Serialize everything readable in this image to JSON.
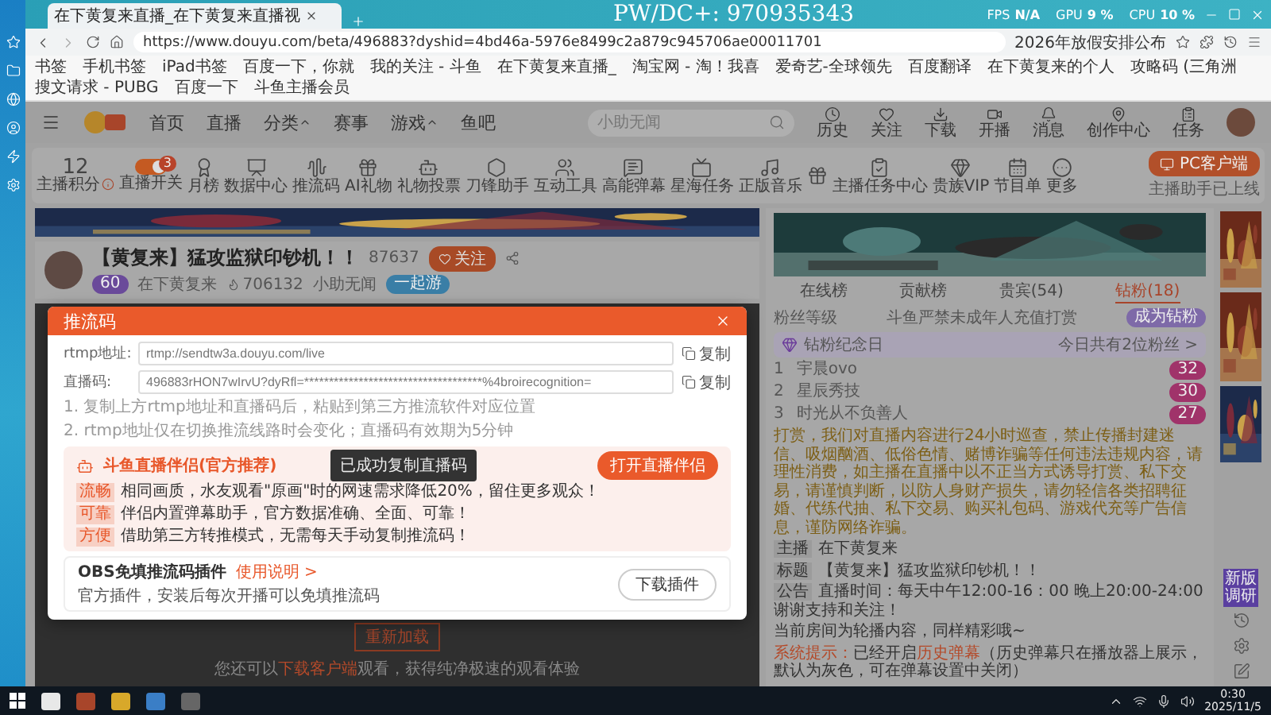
{
  "browser": {
    "tab_title": "在下黄复来直播_在下黄复来直播视",
    "url": "https://www.douyu.com/beta/496883?dyshid=4bd46a-5976e8499c2a879c945706ae00011701",
    "search_hint": "2026年放假安排公布",
    "bookmarks": [
      "书签",
      "手机书签",
      "iPad书签",
      "百度一下，你就",
      "我的关注 - 斗鱼",
      "在下黄复来直播_",
      "淘宝网 - 淘！我喜",
      "爱奇艺-全球领先",
      "百度翻译",
      "在下黄复来的个人",
      "攻略码 (三角洲",
      "搜文请求 - PUBG",
      "百度一下",
      "斗鱼主播会员"
    ]
  },
  "overlay": {
    "caption": "PW/DC+:  970935343",
    "stats": [
      {
        "label": "FPS",
        "value": "N/A"
      },
      {
        "label": "GPU",
        "value": "9 %"
      },
      {
        "label": "CPU",
        "value": "10 %"
      }
    ]
  },
  "site_nav": {
    "items": [
      {
        "label": "首页",
        "dropdown": false
      },
      {
        "label": "直播",
        "dropdown": false
      },
      {
        "label": "分类",
        "dropdown": true
      },
      {
        "label": "赛事",
        "dropdown": false
      },
      {
        "label": "游戏",
        "dropdown": true
      },
      {
        "label": "鱼吧",
        "dropdown": false
      }
    ],
    "search_placeholder": "小助无闻",
    "actions": [
      "历史",
      "关注",
      "下载",
      "开播",
      "消息",
      "创作中心",
      "任务"
    ]
  },
  "tools": {
    "items": [
      {
        "kind": "score",
        "value": "12",
        "label": "主播积分"
      },
      {
        "kind": "toggle",
        "label": "直播开关",
        "on": true,
        "badge": "3"
      },
      {
        "kind": "tool",
        "label": "月榜"
      },
      {
        "kind": "tool",
        "label": "数据中心"
      },
      {
        "kind": "tool",
        "label": "推流码"
      },
      {
        "kind": "tool",
        "label": "AI礼物"
      },
      {
        "kind": "tool",
        "label": "礼物投票"
      },
      {
        "kind": "tool",
        "label": "刀锋助手"
      },
      {
        "kind": "tool",
        "label": "互动工具"
      },
      {
        "kind": "tool",
        "label": "高能弹幕"
      },
      {
        "kind": "tool",
        "label": "星海任务"
      },
      {
        "kind": "tool",
        "label": "正版音乐"
      },
      {
        "kind": "tool"
      },
      {
        "kind": "tool",
        "label": "主播任务中心"
      },
      {
        "kind": "tool",
        "label": "贵族VIP"
      },
      {
        "kind": "tool",
        "label": "节目单"
      },
      {
        "kind": "tool",
        "label": "更多"
      }
    ],
    "pc_button": "PC客户端",
    "pc_note": "主播助手已上线"
  },
  "streamer": {
    "title": "【黄复来】猛攻监狱印钞机！！",
    "followers": "87637",
    "follow": "关注",
    "level": "60",
    "name": "在下黄复来",
    "hot": "706132",
    "category": "小助无闻",
    "tag": "一起游"
  },
  "video": {
    "reload": "重新加载",
    "hint_before": "您还可以",
    "hint_link": "下载客户端",
    "hint_after": "观看，获得纯净极速的观看体验"
  },
  "modal": {
    "title": "推流码",
    "fields": [
      {
        "label": "rtmp地址:",
        "value": "rtmp://sendtw3a.douyu.com/live",
        "action": "复制"
      },
      {
        "label": "直播码:",
        "value": "496883rHON7wIrvU?dyRfl=************************************%4broirecognition=",
        "action": "复制"
      }
    ],
    "notes": [
      "1. 复制上方rtmp地址和直播码后，粘贴到第三方推流软件对应位置",
      "2. rtmp地址仅在切换推流线路时会变化；直播码有效期为5分钟"
    ],
    "toast": "已成功复制直播码",
    "promo": {
      "title": "斗鱼直播伴侣(官方推荐)",
      "button": "打开直播伴侣",
      "features": [
        {
          "tag": "流畅",
          "text": "相同画质，水友观看\"原画\"时的网速需求降低20%，留住更多观众！"
        },
        {
          "tag": "可靠",
          "text": "伴侣内置弹幕助手，官方数据准确、全面、可靠！"
        },
        {
          "tag": "方便",
          "text": "借助第三方转推模式，无需每天手动复制推流码！"
        }
      ]
    },
    "plugin": {
      "title": "OBS免填推流码插件",
      "link": "使用说明 >",
      "description": "官方插件，安装后每次开播可以免填推流码",
      "button": "下载插件"
    }
  },
  "right_panel": {
    "tabs": [
      {
        "label": "在线榜",
        "selected": false
      },
      {
        "label": "贡献榜",
        "selected": false
      },
      {
        "label": "贵宾(54)",
        "selected": false
      },
      {
        "label": "钻粉(18)",
        "selected": true
      }
    ],
    "fan_level": "粉丝等级",
    "minor_notice": "斗鱼严禁未成年人充值打赏",
    "become_fan": "成为钻粉",
    "anniversary": "钻粉纪念日",
    "anniversary_count": "今日共有2位粉丝 >",
    "fans": [
      {
        "rank": "1",
        "name": "宇晨ovo",
        "level": "32"
      },
      {
        "rank": "2",
        "name": "星辰秀技",
        "level": "30"
      },
      {
        "rank": "3",
        "name": "时光从不负善人",
        "level": "27"
      }
    ],
    "notice": "打赏，我们对直播内容进行24小时巡查，禁止传播封建迷信、吸烟酗酒、低俗色情、赌博诈骗等任何违法违规内容，请理性消费，如主播在直播中以不正当方式诱导打赏、私下交易，请谨慎判断，以防人身财产损失，请勿轻信各类招聘征婚、代练代抽、私下交易、购买礼包码、游戏代充等广告信息，谨防网络诈骗。",
    "info": [
      {
        "label": "主播",
        "text": "在下黄复来"
      },
      {
        "label": "标题",
        "text": "【黄复来】猛攻监狱印钞机！！"
      },
      {
        "label": "公告",
        "text": "直播时间：每天中午12:00-16：00 晚上20:00-24:00 谢谢支持和关注！"
      }
    ],
    "room_notice": "当前房间为轮播内容，同样精彩哦~",
    "system_label": "系统提示：",
    "system_before": "已经开启",
    "system_link": "历史弹幕",
    "system_after": "（历史弹幕只在播放器上展示，默认为灰色，可在弹幕设置中关闭）"
  },
  "survey": "新版调研",
  "taskbar": {
    "time": "0:30",
    "date": "2025/11/5"
  }
}
